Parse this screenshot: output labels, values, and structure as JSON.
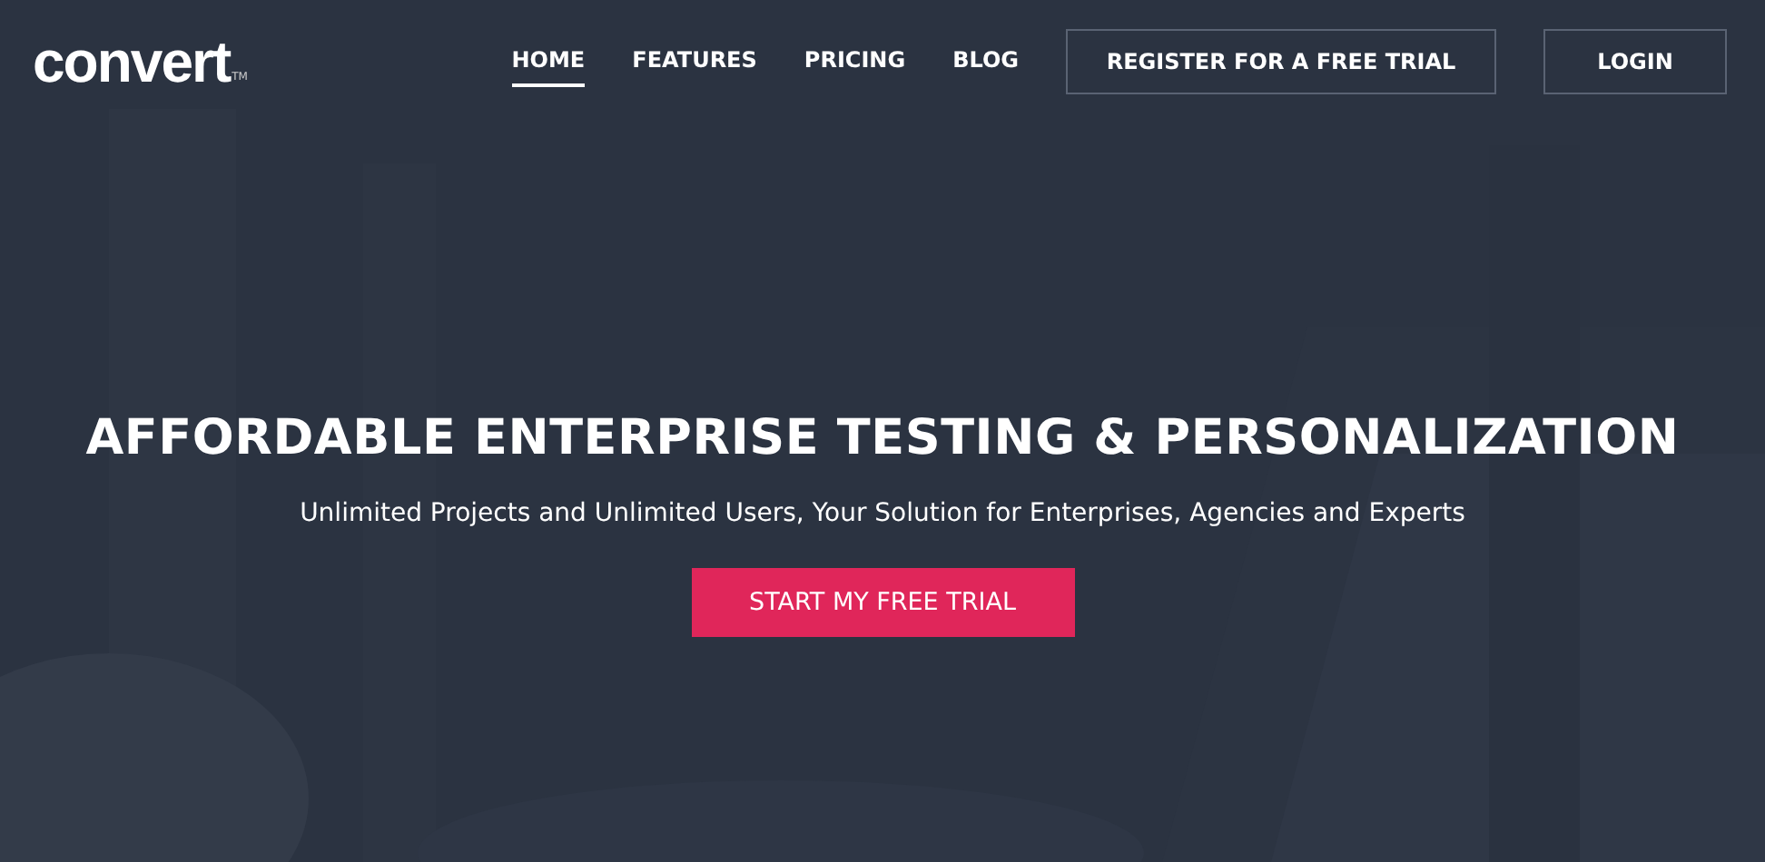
{
  "logo": {
    "text": "convert",
    "trademark": "TM"
  },
  "nav": [
    {
      "label": "HOME",
      "selected": true
    },
    {
      "label": "FEATURES",
      "selected": false
    },
    {
      "label": "PRICING",
      "selected": false
    },
    {
      "label": "BLOG",
      "selected": false
    }
  ],
  "nav_buttons": [
    "REGISTER FOR A FREE TRIAL",
    "LOGIN"
  ],
  "hero": {
    "kind": "picture",
    "title": "AFFORDABLE ENTERPRISE TESTING & PERSONALIZATION",
    "subtitle": "Unlimited Projects and Unlimited Users, Your Solution for Enterprises, Agencies and Experts",
    "cta": "START MY FREE TRIAL"
  }
}
